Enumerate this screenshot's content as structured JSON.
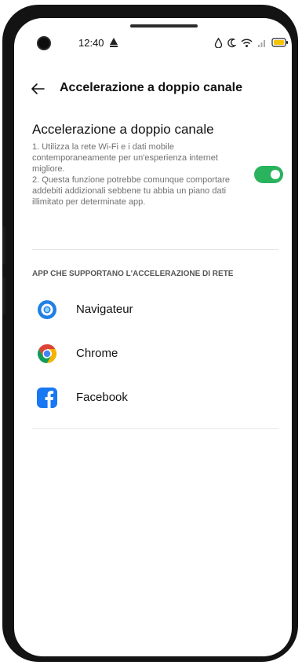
{
  "status_bar": {
    "time": "12:40"
  },
  "header": {
    "title": "Accelerazione a doppio canale"
  },
  "setting": {
    "title": "Accelerazione a doppio canale",
    "description": "1. Utilizza la rete Wi-Fi e i dati mobile contemporaneamente per un'esperienza internet migliore.\n2. Questa funzione potrebbe comunque comportare addebiti addizionali sebbene tu abbia un piano dati illimitato per determinate app.",
    "enabled": true
  },
  "apps_section": {
    "header": "APP CHE SUPPORTANO L'ACCELERAZIONE DI RETE",
    "apps": [
      {
        "label": "Navigateur",
        "icon": "navigateur-icon"
      },
      {
        "label": "Chrome",
        "icon": "chrome-icon"
      },
      {
        "label": "Facebook",
        "icon": "facebook-icon"
      }
    ]
  },
  "colors": {
    "toggle_on": "#29b35d",
    "facebook_blue": "#1877f2",
    "navigateur_blue": "#1f7fe5"
  }
}
